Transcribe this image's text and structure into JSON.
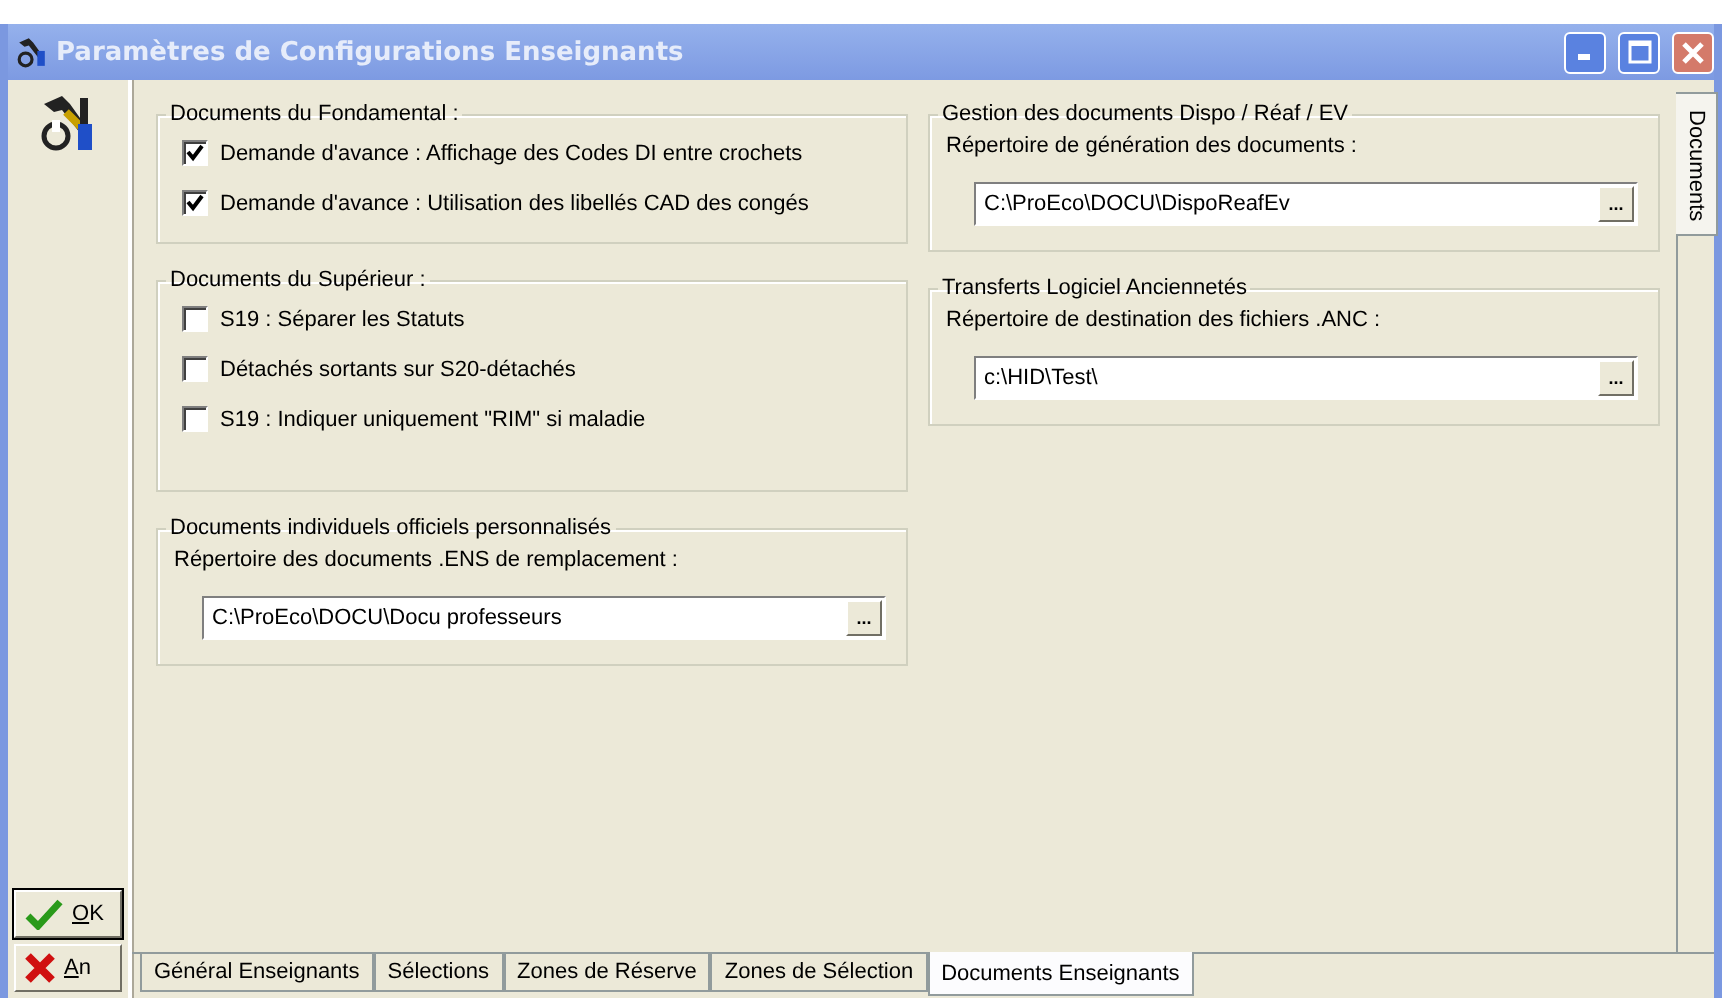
{
  "window": {
    "title": "Paramètres de Configurations Enseignants"
  },
  "toolbar": {
    "buttons": [
      {
        "kind": "ok",
        "label": "OK"
      },
      {
        "kind": "cancel",
        "label": "An"
      }
    ]
  },
  "left_groups": [
    {
      "title": "Documents du Fondamental :",
      "items": [
        {
          "kind": "checkbox",
          "label": "Demande d'avance : Affichage des Codes DI entre crochets",
          "checked": true
        },
        {
          "kind": "checkbox",
          "label": "Demande d'avance : Utilisation des libellés CAD des congés",
          "checked": true
        }
      ]
    },
    {
      "title": "Documents du Supérieur :",
      "items": [
        {
          "kind": "checkbox",
          "label": "S19 : Séparer les Statuts",
          "checked": false
        },
        {
          "kind": "checkbox",
          "label": "Détachés sortants sur S20-détachés",
          "checked": false
        },
        {
          "kind": "checkbox",
          "label": "S19 : Indiquer uniquement \"RIM\" si maladie",
          "checked": false
        }
      ]
    },
    {
      "title": "Documents individuels officiels personnalisés",
      "items": [
        {
          "kind": "path",
          "label": "Répertoire des documents .ENS de remplacement :",
          "value": "C:\\ProEco\\DOCU\\Docu professeurs",
          "button": "..."
        }
      ]
    }
  ],
  "right_groups": [
    {
      "title": "Gestion des documents Dispo / Réaf / EV",
      "items": [
        {
          "kind": "path",
          "label": "Répertoire de génération des documents :",
          "value": "C:\\ProEco\\DOCU\\DispoReafEv",
          "button": "..."
        }
      ]
    },
    {
      "title": "Transferts Logiciel Anciennetés",
      "items": [
        {
          "kind": "path",
          "label": "Répertoire de destination des fichiers .ANC :",
          "value": "c:\\HID\\Test\\",
          "button": "..."
        }
      ]
    }
  ],
  "side_tabs": [
    {
      "label": "Documents",
      "selected": true
    }
  ],
  "bottom_tabs": [
    {
      "label": "Général Enseignants",
      "selected": false
    },
    {
      "label": "Sélections",
      "selected": false
    },
    {
      "label": "Zones de Réserve",
      "selected": false
    },
    {
      "label": "Zones de Sélection",
      "selected": false
    },
    {
      "label": "Documents Enseignants",
      "selected": true
    }
  ]
}
